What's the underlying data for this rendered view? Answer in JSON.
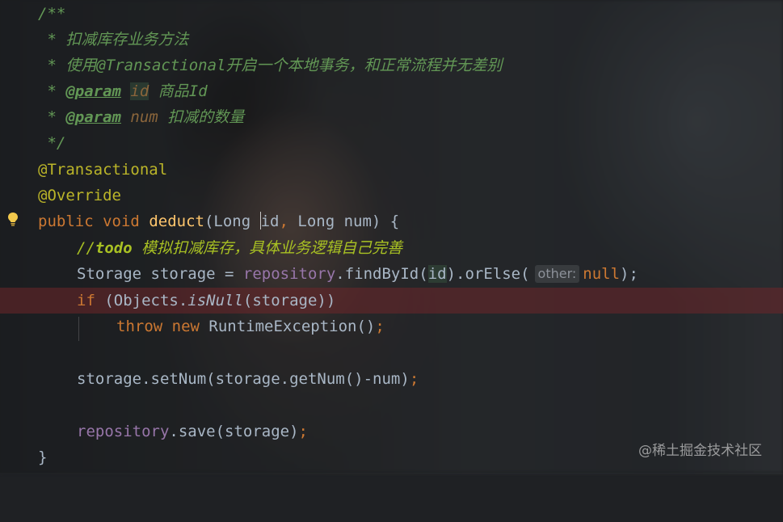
{
  "editor": {
    "lines": {
      "doc_open": "/**",
      "doc_desc": " * 扣减库存业务方法",
      "doc_desc2_prefix": " * 使用",
      "doc_desc2_ann": "@Transactional",
      "doc_desc2_rest": "开启一个本地事务，和正常流程并无差别",
      "doc_star": " * ",
      "param_tag": "@param",
      "param1_name": "id",
      "param1_desc": "商品Id",
      "param2_name": "num",
      "param2_desc": "扣减的数量",
      "doc_close": " */",
      "ann_transactional": "@Transactional",
      "ann_override": "@Override",
      "sig_public": "public",
      "sig_void": "void",
      "sig_method": "deduct",
      "sig_open": "(Long ",
      "sig_id": "id",
      "sig_comma": ", ",
      "sig_long": "Long num) {",
      "todo_slashes": "//",
      "todo_kw": "todo",
      "todo_text": " 模拟扣减库存，具体业务逻辑自己完善",
      "storage_decl": "Storage storage = ",
      "repository": "repository",
      "find_call": ".findById(",
      "find_id": "id",
      "or_else": ").orElse(",
      "hint_other": "other:",
      "null_kw": "null",
      "close_paren_semi": ");",
      "if_kw": "if",
      "if_open": " (Objects.",
      "is_null": "isNull",
      "if_rest": "(storage))",
      "throw_kw": "throw",
      "new_kw": "new",
      "runtime_exc": " RuntimeException()",
      "semi": ";",
      "set_num": "storage.setNum(storage.getNum()-num)",
      "save_call": ".save(storage)",
      "close_brace": "}"
    }
  },
  "watermark": "@稀土掘金技术社区",
  "icons": {
    "gutter": "lightbulb-icon"
  },
  "colors": {
    "keyword": "#cc7832",
    "annotation": "#bbb529",
    "method": "#ffc66d",
    "field": "#9876aa",
    "doc_comment": "#629755",
    "todo": "#a8c023",
    "default_text": "#a9b7c6"
  }
}
